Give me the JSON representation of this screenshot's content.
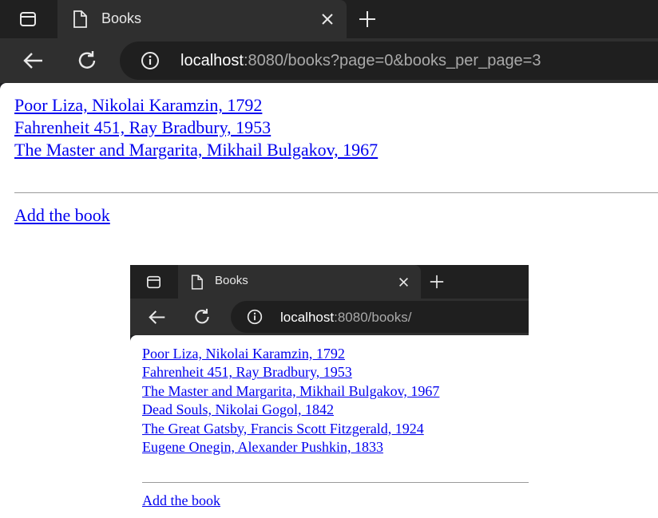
{
  "window1": {
    "tab_title": "Books",
    "url_host": "localhost",
    "url_path": ":8080/books?page=0&books_per_page=3",
    "books": [
      "Poor Liza, Nikolai Karamzin, 1792",
      "Fahrenheit 451, Ray Bradbury, 1953",
      "The Master and Margarita, Mikhail Bulgakov, 1967"
    ],
    "add_link": "Add the book"
  },
  "window2": {
    "tab_title": "Books",
    "url_host": "localhost",
    "url_path": ":8080/books/",
    "books": [
      "Poor Liza, Nikolai Karamzin, 1792",
      "Fahrenheit 451, Ray Bradbury, 1953",
      "The Master and Margarita, Mikhail Bulgakov, 1967",
      "Dead Souls, Nikolai Gogol, 1842",
      "The Great Gatsby, Francis Scott Fitzgerald, 1924",
      "Eugene Onegin, Alexander Pushkin, 1833"
    ],
    "add_link": "Add the book"
  },
  "colors": {
    "link": "#0000ee",
    "chrome_dark": "#202020",
    "toolbar": "#2f2f2f"
  }
}
